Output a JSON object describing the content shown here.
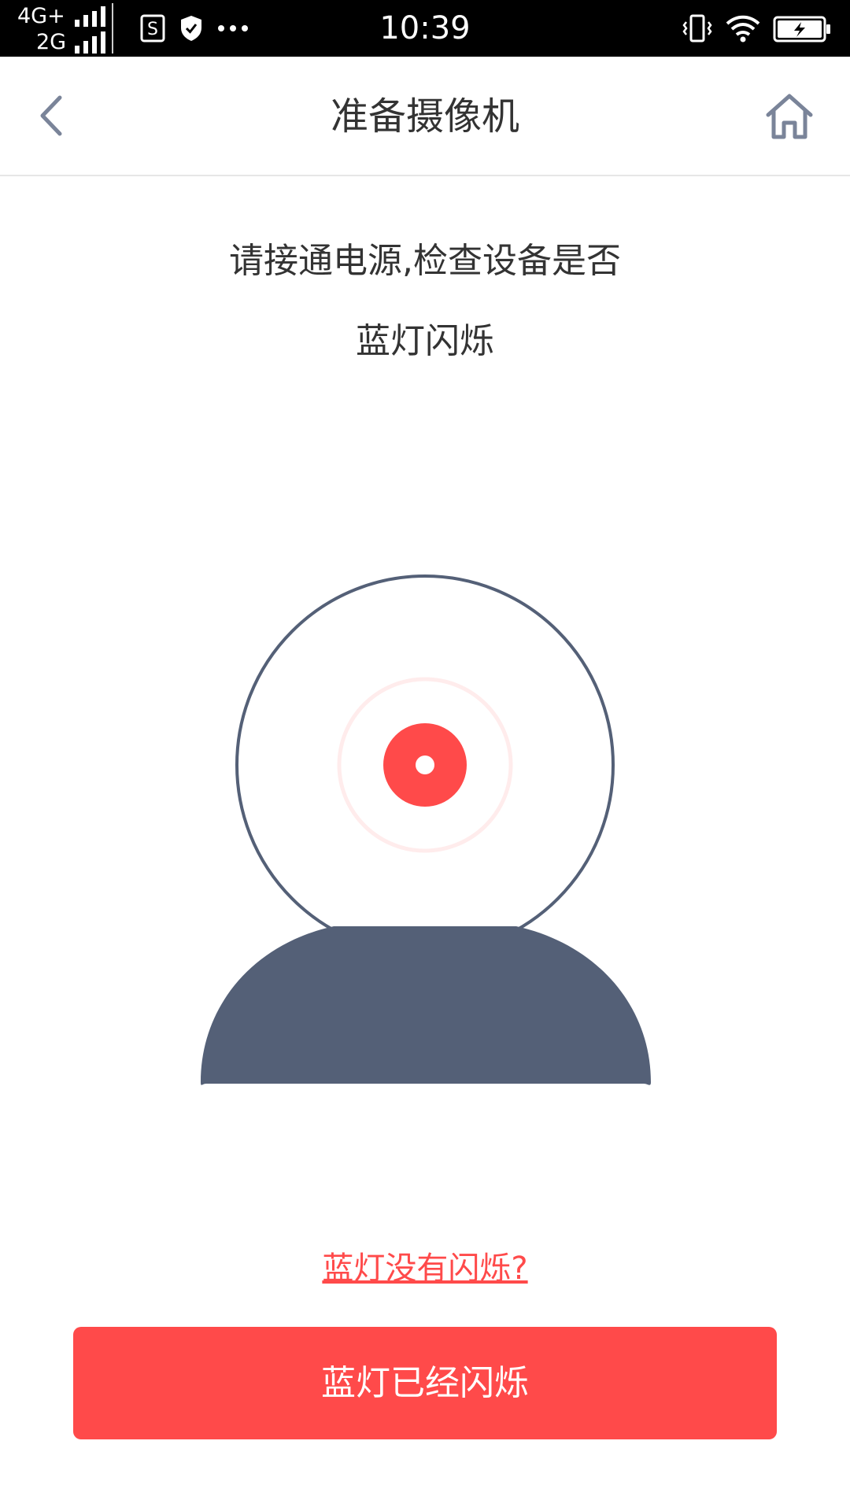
{
  "status_bar": {
    "network_primary": "4G+",
    "network_secondary": "2G",
    "time": "10:39",
    "icons": [
      "signal-icon",
      "sim-app-icon",
      "shield-icon",
      "more-icon",
      "vibrate-icon",
      "wifi-icon",
      "battery-charging-icon"
    ]
  },
  "header": {
    "title": "准备摄像机",
    "back_icon": "chevron-left-icon",
    "home_icon": "home-icon"
  },
  "instruction": {
    "line1": "请接通电源,检查设备是否",
    "line2": "蓝灯闪烁"
  },
  "illustration": {
    "name": "camera-icon",
    "lens_color": "#ff4a4a",
    "body_color": "#546077"
  },
  "help_link": "蓝灯没有闪烁?",
  "confirm_button": "蓝灯已经闪烁",
  "colors": {
    "accent": "#ff4a4a",
    "text": "#333333",
    "icon": "#7a8499"
  }
}
